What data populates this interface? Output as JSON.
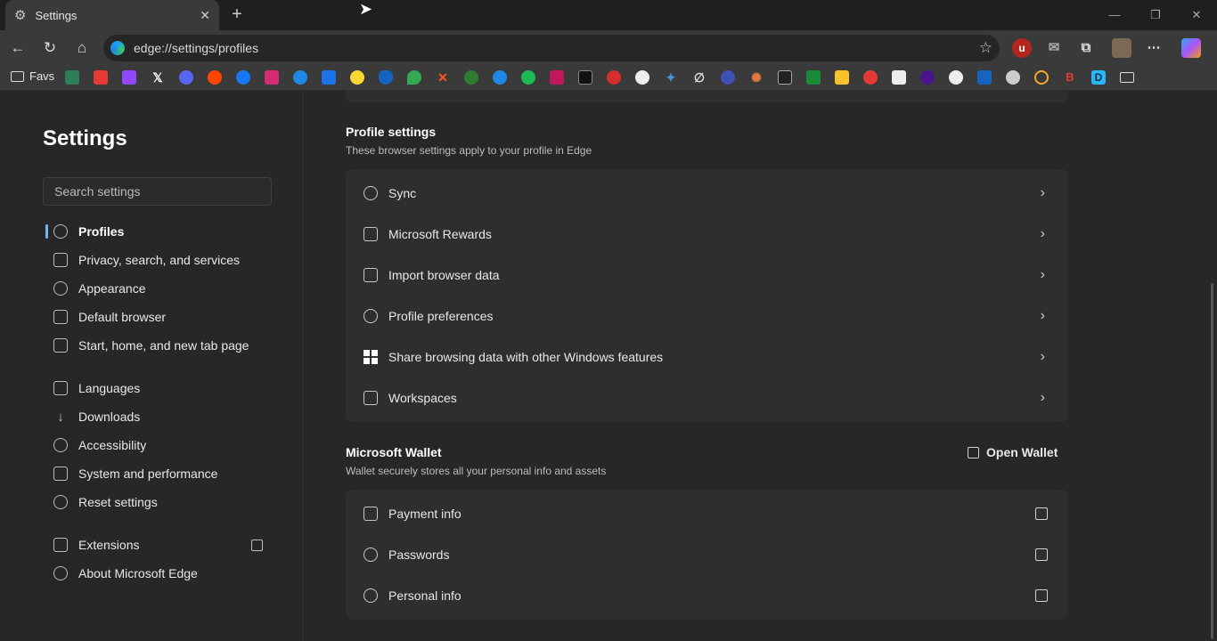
{
  "tab": {
    "title": "Settings",
    "close": "✕",
    "new_tab": "+"
  },
  "window_controls": {
    "minimize": "—",
    "restore": "❐",
    "close": "✕"
  },
  "address_bar": {
    "url": "edge://settings/profiles"
  },
  "favorites": {
    "folder_label": "Favs"
  },
  "sidebar": {
    "title": "Settings",
    "search_placeholder": "Search settings",
    "items": [
      {
        "label": "Profiles"
      },
      {
        "label": "Privacy, search, and services"
      },
      {
        "label": "Appearance"
      },
      {
        "label": "Default browser"
      },
      {
        "label": "Start, home, and new tab page"
      },
      {
        "label": "Languages"
      },
      {
        "label": "Downloads"
      },
      {
        "label": "Accessibility"
      },
      {
        "label": "System and performance"
      },
      {
        "label": "Reset settings"
      },
      {
        "label": "Extensions"
      },
      {
        "label": "About Microsoft Edge"
      }
    ]
  },
  "profile_settings": {
    "title": "Profile settings",
    "subtitle": "These browser settings apply to your profile in Edge",
    "rows": [
      {
        "label": "Sync"
      },
      {
        "label": "Microsoft Rewards"
      },
      {
        "label": "Import browser data"
      },
      {
        "label": "Profile preferences"
      },
      {
        "label": "Share browsing data with other Windows features"
      },
      {
        "label": "Workspaces"
      }
    ]
  },
  "wallet": {
    "title": "Microsoft Wallet",
    "subtitle": "Wallet securely stores all your personal info and assets",
    "open_label": "Open Wallet",
    "rows": [
      {
        "label": "Payment info"
      },
      {
        "label": "Passwords"
      },
      {
        "label": "Personal info"
      }
    ]
  },
  "colors": {
    "accent": "#6cb8f6",
    "background": "#272727",
    "card": "#2e2e2e"
  }
}
